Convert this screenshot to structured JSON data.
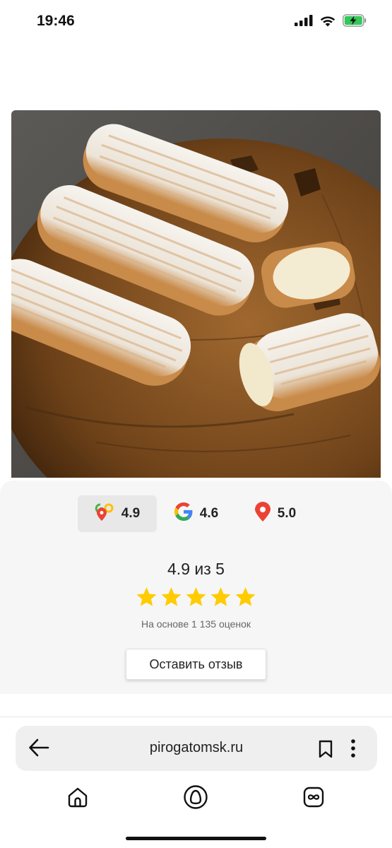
{
  "status_bar": {
    "time": "19:46"
  },
  "colors": {
    "star": "#FFCC00",
    "pin_red": "#EA4335",
    "card_bg": "#f6f6f6",
    "battery_green": "#34C759"
  },
  "photo": {
    "icon": "eclairs-photo"
  },
  "ratings": {
    "tabs": [
      {
        "icon": "yandex-maps-icon",
        "value": "4.9",
        "active": true
      },
      {
        "icon": "google-icon",
        "value": "4.6",
        "active": false
      },
      {
        "icon": "map-pin-icon",
        "value": "5.0",
        "active": false
      }
    ],
    "score_text": "4.9 из 5",
    "stars": 5,
    "based_on": "На основе 1 135 оценок",
    "review_button": "Оставить отзыв"
  },
  "browser": {
    "url": "pirogatomsk.ru"
  }
}
